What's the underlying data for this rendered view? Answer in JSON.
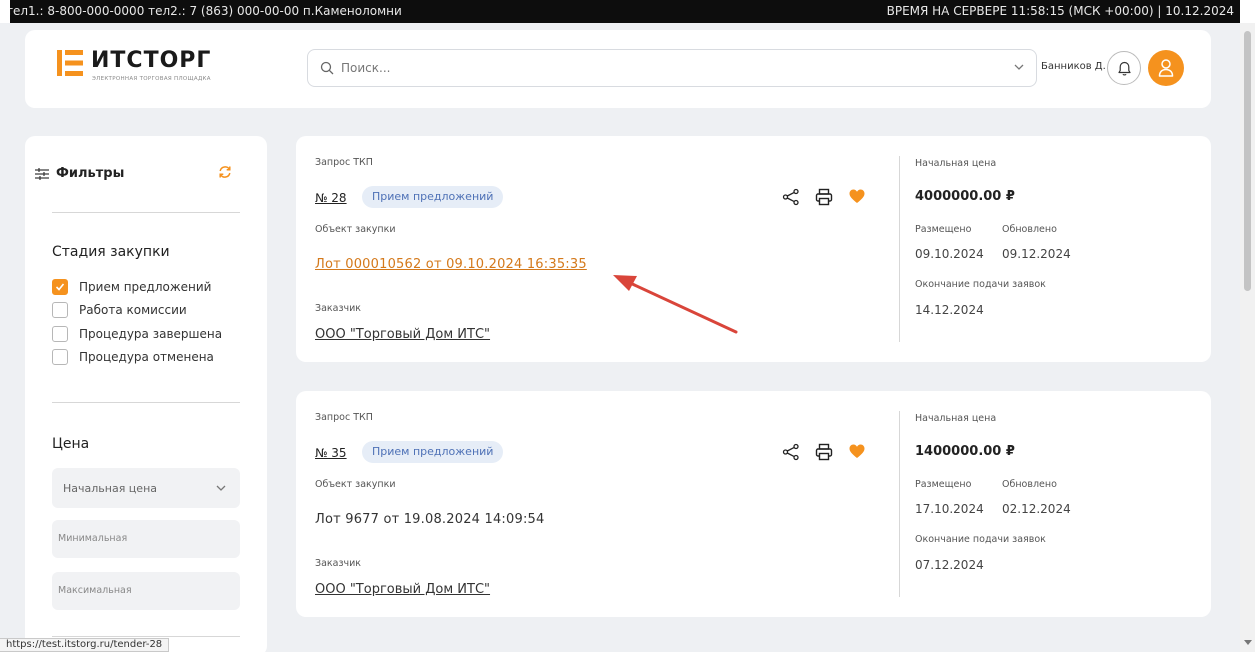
{
  "topbar": {
    "phones": "тел1.: 8-800-000-0000  тел2.: 7 (863) 000-00-00 п.Каменоломни",
    "server_time": "ВРЕМЯ НА СЕРВЕРЕ   11:58:15 (МСК +00:00) | 10.12.2024"
  },
  "header": {
    "logo_text": "ИТСТОРГ",
    "logo_sub": "ЭЛЕКТРОННАЯ ТОРГОВАЯ ПЛОЩАДКА",
    "search_placeholder": "Поиск...",
    "user_name": "Банников Д."
  },
  "sidebar": {
    "filters_title": "Фильтры",
    "stage_title": "Стадия закупки",
    "stages": [
      {
        "label": "Прием предложений",
        "checked": true
      },
      {
        "label": "Работа комиссии",
        "checked": false
      },
      {
        "label": "Процедура завершена",
        "checked": false
      },
      {
        "label": "Процедура отменена",
        "checked": false
      }
    ],
    "price_title": "Цена",
    "price_select": "Начальная цена",
    "min_placeholder": "Минимальная",
    "max_placeholder": "Максимальная"
  },
  "cards": [
    {
      "type": "Запрос ТКП",
      "number": "№ 28",
      "status": "Прием предложений",
      "object_label": "Объект закупки",
      "object": "Лот 000010562 от 09.10.2024 16:35:35",
      "customer_label": "Заказчик",
      "customer": "ООО \"Торговый Дом ИТС\"",
      "price_label": "Начальная цена",
      "price": "4000000.00 ₽",
      "placed_label": "Размещено",
      "updated_label": "Обновлено",
      "placed": "09.10.2024",
      "updated": "09.12.2024",
      "end_label": "Окончание подачи заявок",
      "end": "14.12.2024"
    },
    {
      "type": "Запрос ТКП",
      "number": "№ 35",
      "status": "Прием предложений",
      "object_label": "Объект закупки",
      "object": "Лот 9677 от 19.08.2024 14:09:54",
      "customer_label": "Заказчик",
      "customer": "ООО \"Торговый Дом ИТС\"",
      "price_label": "Начальная цена",
      "price": "1400000.00 ₽",
      "placed_label": "Размещено",
      "updated_label": "Обновлено",
      "placed": "17.10.2024",
      "updated": "02.12.2024",
      "end_label": "Окончание подачи заявок",
      "end": "07.12.2024"
    }
  ],
  "status_url": "https://test.itstorg.ru/tender-28",
  "colors": {
    "accent": "#f5921e",
    "link": "#d4791b",
    "badge_bg": "#e6edf7",
    "badge_text": "#4e71b6",
    "arrow": "#d9453a"
  },
  "icons": [
    "search-icon",
    "chevron-down-icon",
    "bell-icon",
    "user-icon",
    "filter-icon",
    "refresh-icon",
    "share-icon",
    "print-icon",
    "heart-icon",
    "check-icon"
  ]
}
